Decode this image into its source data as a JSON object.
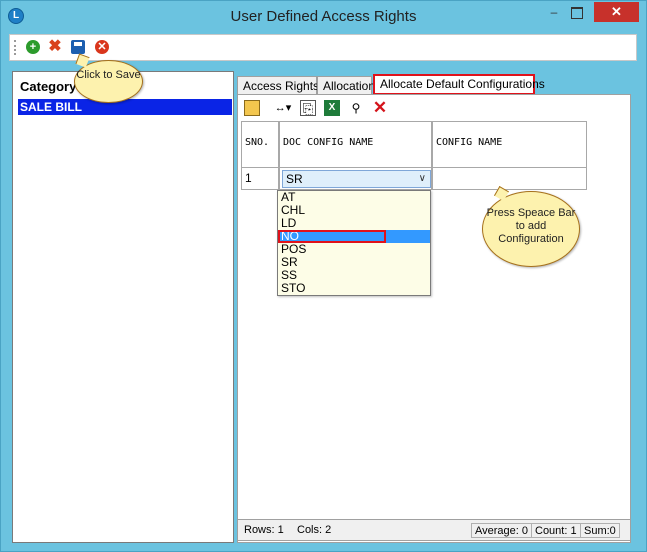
{
  "window": {
    "title": "User Defined Access Rights",
    "app_icon": "app-logo-icon",
    "controls": {
      "minimize": "–",
      "maximize": "",
      "close": "✕"
    }
  },
  "toolbar": {
    "buttons": [
      {
        "name": "add-icon",
        "glyph": "+"
      },
      {
        "name": "delete-icon",
        "glyph": "✖"
      },
      {
        "name": "save-icon",
        "glyph": ""
      },
      {
        "name": "close-icon",
        "glyph": "✕"
      }
    ]
  },
  "sidebar": {
    "header": "Category",
    "items": [
      {
        "label": "SALE BILL",
        "selected": true
      }
    ]
  },
  "tabs": [
    {
      "label": "Access Rights",
      "active": false
    },
    {
      "label": "Allocation",
      "active": false
    },
    {
      "label": "Allocate Default Configurations",
      "active": true
    }
  ],
  "grid_toolbar": {
    "buttons": [
      {
        "name": "save-grid-icon",
        "glyph": ""
      },
      {
        "name": "column-width-icon",
        "glyph": "↔▾"
      },
      {
        "name": "copy-icon",
        "glyph": "⎘"
      },
      {
        "name": "excel-icon",
        "glyph": "X"
      },
      {
        "name": "binoculars-icon",
        "glyph": "⚲"
      },
      {
        "name": "remove-icon",
        "glyph": "✕"
      }
    ]
  },
  "grid": {
    "columns": [
      "SNO.",
      "DOC CONFIG NAME",
      "CONFIG NAME"
    ],
    "rows": [
      {
        "sno": "1",
        "doc_config": "SR",
        "config": ""
      }
    ]
  },
  "dropdown": {
    "options": [
      "AT",
      "CHL",
      "LD",
      "NO",
      "POS",
      "SR",
      "SS",
      "STO"
    ],
    "highlighted": "NO"
  },
  "status": {
    "rows": "Rows: 1",
    "cols": "Cols: 2",
    "average": "Average: 0",
    "count": "Count: 1",
    "sum": "Sum:0"
  },
  "callouts": {
    "save": "Click to Save",
    "space": "Press Speace Bar to add Configuration"
  },
  "colors": {
    "window_frame": "#6bc3e0",
    "close_button": "#c7312b",
    "selection_blue": "#0a24e6",
    "highlight": "#3399ff",
    "annotation_red": "#e0121b",
    "callout_fill": "#fdf2ae"
  }
}
